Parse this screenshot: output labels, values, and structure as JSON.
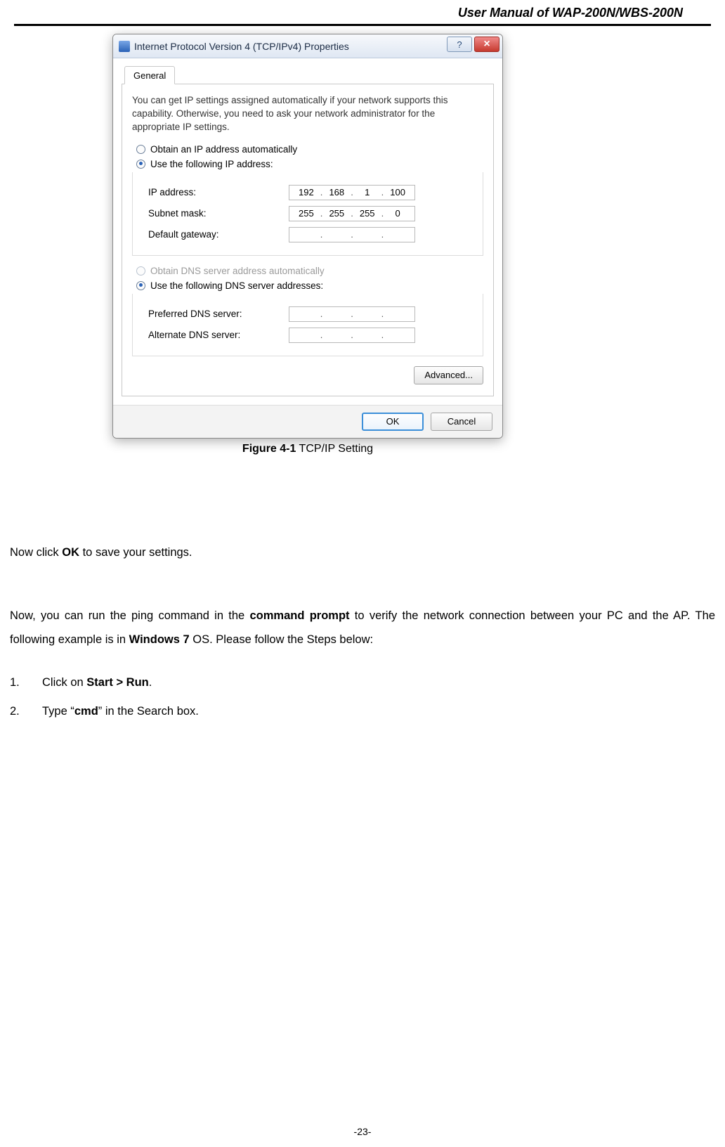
{
  "header": {
    "title": "User Manual of WAP-200N/WBS-200N"
  },
  "dialog": {
    "title": "Internet Protocol Version 4 (TCP/IPv4) Properties",
    "help_glyph": "?",
    "close_glyph": "×",
    "tab_general": "General",
    "description": "You can get IP settings assigned automatically if your network supports this capability. Otherwise, you need to ask your network administrator for the appropriate IP settings.",
    "radio_auto_ip": "Obtain an IP address automatically",
    "radio_use_ip": "Use the following IP address:",
    "label_ip": "IP address:",
    "label_subnet": "Subnet mask:",
    "label_gateway": "Default gateway:",
    "radio_auto_dns": "Obtain DNS server address automatically",
    "radio_use_dns": "Use the following DNS server addresses:",
    "label_pref_dns": "Preferred DNS server:",
    "label_alt_dns": "Alternate DNS server:",
    "ip": {
      "a": "192",
      "b": "168",
      "c": "1",
      "d": "100"
    },
    "subnet": {
      "a": "255",
      "b": "255",
      "c": "255",
      "d": "0"
    },
    "gateway": {
      "a": "",
      "b": "",
      "c": "",
      "d": ""
    },
    "pref_dns": {
      "a": "",
      "b": "",
      "c": "",
      "d": ""
    },
    "alt_dns": {
      "a": "",
      "b": "",
      "c": "",
      "d": ""
    },
    "btn_advanced": "Advanced...",
    "btn_ok": "OK",
    "btn_cancel": "Cancel"
  },
  "caption": {
    "fig": "Figure 4-1",
    "text": " TCP/IP Setting"
  },
  "body": {
    "p1_a": "Now click ",
    "p1_b": "OK",
    "p1_c": " to save your settings.",
    "p2_a": "Now, you can run the ping command in the ",
    "p2_b": "command prompt",
    "p2_c": " to verify the network connection between your PC and the AP. The following example is in ",
    "p2_d": "Windows 7",
    "p2_e": " OS. Please follow the Steps below:",
    "s1_n": "1.",
    "s1_a": "Click on ",
    "s1_b": "Start > Run",
    "s1_c": ".",
    "s2_n": "2.",
    "s2_a": "Type “",
    "s2_b": "cmd",
    "s2_c": "” in the Search box."
  },
  "page_number": "-23-"
}
